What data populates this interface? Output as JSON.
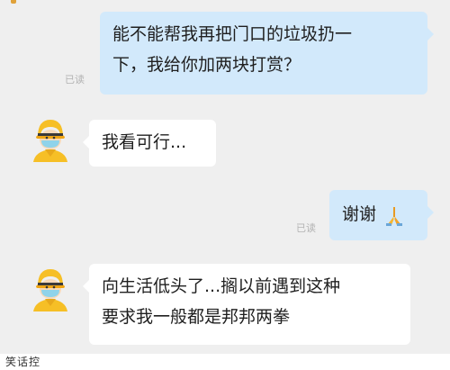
{
  "read_label": "已读",
  "messages": {
    "m1": {
      "line1": "能不能帮我再把门口的垃圾扔一",
      "line2": "下，我给你加两块打赏？"
    },
    "m2": {
      "text": "我看可行..."
    },
    "m3": {
      "text": "谢谢"
    },
    "m4": {
      "line1": "向生活低头了...搁以前遇到这种",
      "line2": "要求我一般都是邦邦两拳"
    }
  },
  "watermark": "笑话控",
  "colors": {
    "outgoing_bubble": "#d2e9fb",
    "incoming_bubble": "#ffffff",
    "background": "#efefef",
    "courier_helmet": "#f6bf26"
  },
  "icons": [
    "courier-avatar-icon",
    "praying-hands-emoji-icon"
  ]
}
